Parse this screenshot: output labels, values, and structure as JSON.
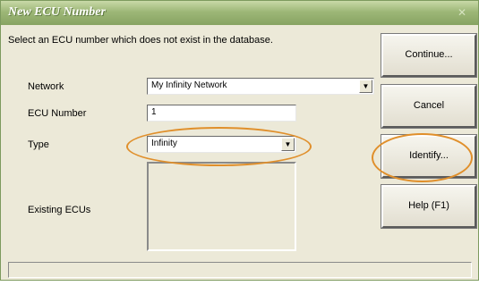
{
  "window": {
    "title": "New ECU Number"
  },
  "instruction": "Select an ECU number which does not exist in the database.",
  "form": {
    "network_label": "Network",
    "network_value": "My Infinity Network",
    "ecu_number_label": "ECU Number",
    "ecu_number_value": "1",
    "type_label": "Type",
    "type_value": "Infinity",
    "existing_ecus_label": "Existing ECUs"
  },
  "buttons": {
    "continue": "Continue...",
    "cancel": "Cancel",
    "identify": "Identify...",
    "help": "Help (F1)"
  },
  "highlight_color": "#e08f2b"
}
